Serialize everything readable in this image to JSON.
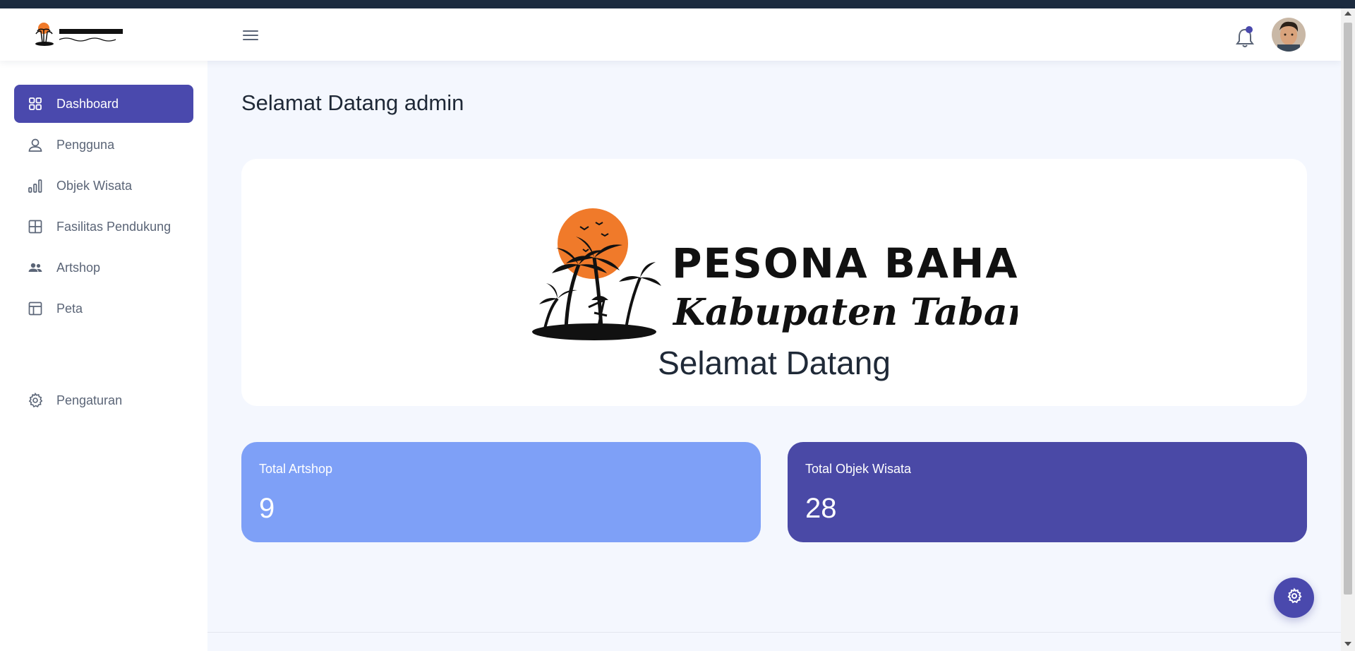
{
  "header": {
    "brand_logo": "pesona-bahari-logo",
    "menu_icon": "hamburger-menu-icon",
    "notification_icon": "bell-icon",
    "avatar": "user-avatar"
  },
  "sidebar": {
    "items": [
      {
        "label": "Dashboard",
        "icon": "grid-icon",
        "active": true
      },
      {
        "label": "Pengguna",
        "icon": "user-icon",
        "active": false
      },
      {
        "label": "Objek Wisata",
        "icon": "bar-chart-icon",
        "active": false
      },
      {
        "label": "Fasilitas Pendukung",
        "icon": "table-grid-icon",
        "active": false
      },
      {
        "label": "Artshop",
        "icon": "people-icon",
        "active": false
      },
      {
        "label": "Peta",
        "icon": "layout-icon",
        "active": false
      },
      {
        "label": "Pengaturan",
        "icon": "gear-icon",
        "active": false
      }
    ]
  },
  "main": {
    "title": "Selamat Datang admin",
    "hero": {
      "logo": "pesona-bahari-kabupaten-tabanan-logo",
      "welcome": "Selamat Datang"
    },
    "cards": [
      {
        "label": "Total Artshop",
        "value": "9",
        "color": "#7ea0f7"
      },
      {
        "label": "Total Objek Wisata",
        "value": "28",
        "color": "#4a49a6"
      }
    ]
  },
  "fab": {
    "icon": "gear-icon"
  },
  "colors": {
    "accent": "#4a49ad",
    "background": "#f4f7fe",
    "notification_dot": "#4a49ad"
  }
}
